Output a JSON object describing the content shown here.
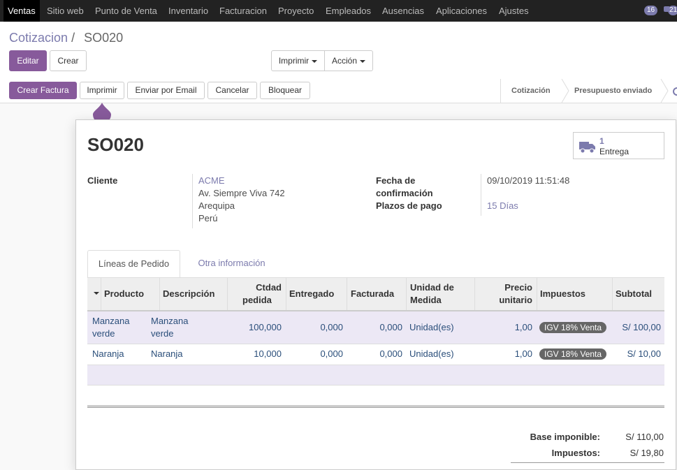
{
  "topbar": {
    "apps": [
      "Ventas",
      "Sitio web",
      "Punto de Venta",
      "Inventario",
      "Facturacion",
      "Proyecto",
      "Empleados",
      "Ausencias",
      "Aplicaciones",
      "Ajustes"
    ],
    "badge1": "16",
    "badge2": "21"
  },
  "breadcrumb": {
    "parent": "Cotizacion",
    "separator": "/",
    "current": "SO020"
  },
  "toolbar": {
    "edit": "Editar",
    "create": "Crear",
    "print": "Imprimir",
    "action": "Acción"
  },
  "statusbar": {
    "buttons": [
      "Crear Factura",
      "Imprimir",
      "Enviar por Email",
      "Cancelar",
      "Bloquear"
    ],
    "stages": [
      "Cotización",
      "Presupuesto enviado"
    ]
  },
  "record": {
    "name": "SO020",
    "smart_button": {
      "value": "1",
      "label": "Entrega",
      "icon": "truck-icon"
    },
    "customer_label": "Cliente",
    "customer": {
      "name": "ACME",
      "street": "Av. Siempre Viva 742",
      "city": "Arequipa",
      "country": "Perú"
    },
    "confirmation_label_1": "Fecha de",
    "confirmation_label_2": "confirmación",
    "confirmation_date": "09/10/2019 11:51:48",
    "payment_terms_label": "Plazos de pago",
    "payment_terms": "15 Días"
  },
  "tabs": [
    "Líneas de Pedido",
    "Otra información"
  ],
  "lines": {
    "headers": {
      "product": "Producto",
      "description": "Descripción",
      "qty_1": "Ctdad",
      "qty_2": "pedida",
      "delivered": "Entregado",
      "invoiced": "Facturada",
      "uom_1": "Unidad de",
      "uom_2": "Medida",
      "price_1": "Precio",
      "price_2": "unitario",
      "taxes": "Impuestos",
      "subtotal": "Subtotal"
    },
    "rows": [
      {
        "product_1": "Manzana",
        "product_2": "verde",
        "desc_1": "Manzana",
        "desc_2": "verde",
        "qty": "100,000",
        "delivered": "0,000",
        "invoiced": "0,000",
        "uom": "Unidad(es)",
        "price": "1,00",
        "tax": "IGV 18% Venta",
        "subtotal": "S/ 100,00"
      },
      {
        "product_1": "Naranja",
        "desc_1": "Naranja",
        "qty": "10,000",
        "delivered": "0,000",
        "invoiced": "0,000",
        "uom": "Unidad(es)",
        "price": "1,00",
        "tax": "IGV 18% Venta",
        "subtotal": "S/ 10,00"
      }
    ]
  },
  "totals": {
    "base_label": "Base imponible:",
    "base_value": "S/ 110,00",
    "tax_label": "Impuestos:",
    "tax_value": "S/ 19,80"
  },
  "colors": {
    "brand": "#875a9b",
    "link": "#7c7bad",
    "topbar": "#222222"
  }
}
